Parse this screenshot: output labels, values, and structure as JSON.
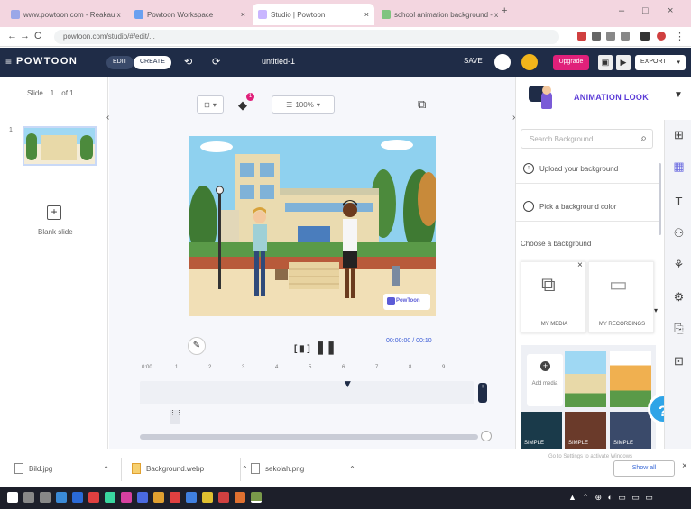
{
  "browser": {
    "tabs": [
      {
        "label": "www.powtoon.com - Reakau x",
        "color": "#9aa7e8"
      },
      {
        "label": "Powtoon Workspace",
        "color": "#6aa0f0"
      },
      {
        "label": "Studio | Powtoon",
        "color": "#e0d0ff"
      },
      {
        "label": "school animation background - x",
        "color": "#7fc47f"
      }
    ],
    "new_tab": "+",
    "window_controls": {
      "minimize": "–",
      "maximize": "□",
      "close": "×"
    },
    "nav": {
      "back": "←",
      "forward": "→",
      "reload": "C"
    },
    "url": "powtoon.com/studio/#/edit/..."
  },
  "app": {
    "logo": "POWTOON",
    "edit_mode": "EDIT",
    "create_mode": "CREATE",
    "doc_title": "untitled-1",
    "save_label": "SAVE",
    "upgrade_label": "Upgrade",
    "export_label": "EXPORT",
    "colors": {
      "bar": "#1f2c47",
      "accent": "#e0207a",
      "primary": "#2a5bd7"
    }
  },
  "left_panel": {
    "slide_label": "Slide",
    "slide_num": "1",
    "of_label": "of 1",
    "slide_index": "1",
    "blank_slide": "Blank slide"
  },
  "canvas_toolbar": {
    "zoom": "100%",
    "notification_count": "1",
    "watermark": "PowToon"
  },
  "timeline": {
    "time": "00:00:00 / 00:10",
    "ticks": [
      "0:00",
      "1",
      "2",
      "3",
      "4",
      "5",
      "6",
      "7",
      "8",
      "9"
    ],
    "play_label": "[ ▮ ]",
    "playhead_fraction": 0.62
  },
  "right_panel": {
    "header_title": "ANIMATION LOOK",
    "search_placeholder": "Search Background",
    "upload_bg": "Upload your background",
    "pick_color": "Pick a background color",
    "choose_bg": "Choose a background",
    "my_media": "MY MEDIA",
    "my_recordings": "MY RECORDINGS",
    "add_media": "Add media",
    "thumb_label": "SIMPLE",
    "help": "?"
  },
  "downloads": {
    "items": [
      {
        "name": "Bild.jpg"
      },
      {
        "name": "Background.webp"
      },
      {
        "name": "sekolah.png"
      }
    ],
    "show_all": "Show all",
    "hint": "Go to Settings to activate Windows"
  }
}
